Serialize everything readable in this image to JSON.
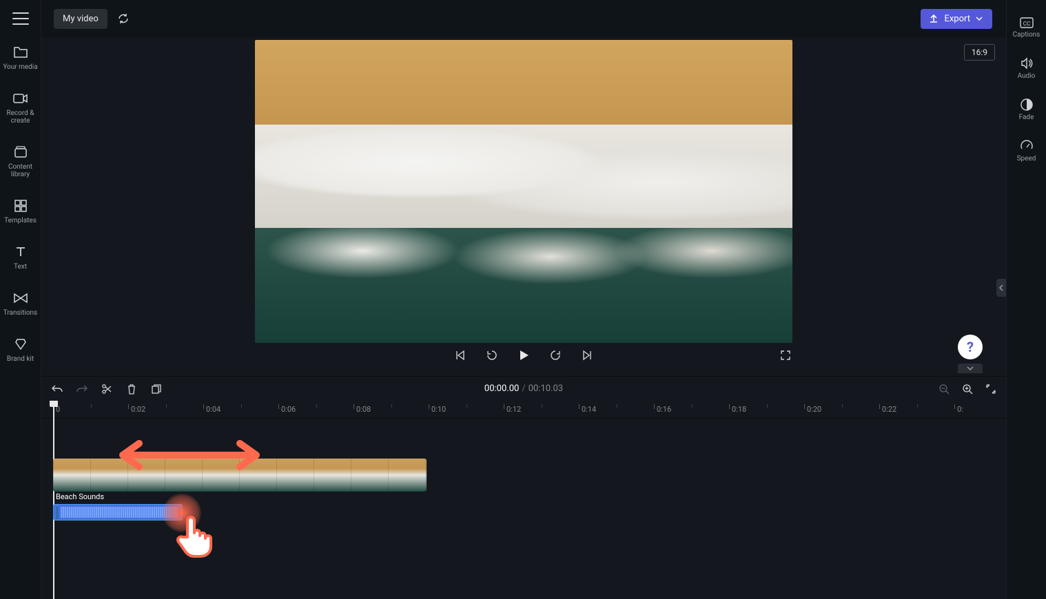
{
  "header": {
    "title": "My video",
    "export_label": "Export"
  },
  "left_sidebar": {
    "items": [
      {
        "label": "Your media"
      },
      {
        "label": "Record &\ncreate"
      },
      {
        "label": "Content\nlibrary"
      },
      {
        "label": "Templates"
      },
      {
        "label": "Text"
      },
      {
        "label": "Transitions"
      },
      {
        "label": "Brand kit"
      }
    ]
  },
  "right_sidebar": {
    "items": [
      {
        "label": "Captions"
      },
      {
        "label": "Audio"
      },
      {
        "label": "Fade"
      },
      {
        "label": "Speed"
      }
    ]
  },
  "preview": {
    "aspect_ratio": "16:9"
  },
  "timecode": {
    "current": "00:00.00",
    "total": "00:10.03"
  },
  "ruler": {
    "ticks": [
      "0",
      "0:02",
      "0:04",
      "0:06",
      "0:08",
      "0:10",
      "0:12",
      "0:14",
      "0:16",
      "0:18",
      "0:20",
      "0:22",
      "0:"
    ]
  },
  "timeline": {
    "audio_clip_label": "Beach Sounds"
  }
}
